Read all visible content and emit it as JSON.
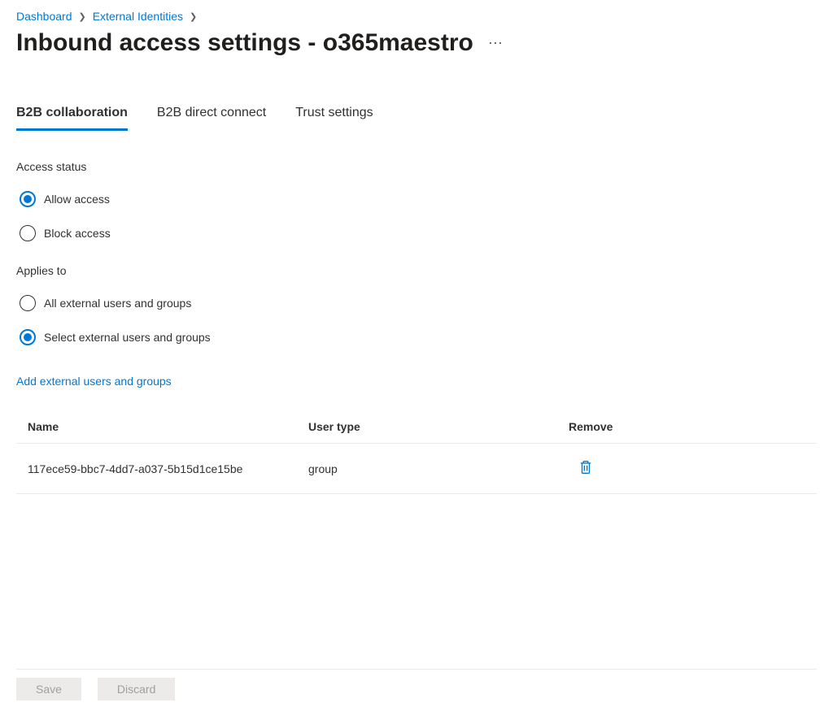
{
  "breadcrumb": {
    "items": [
      {
        "label": "Dashboard"
      },
      {
        "label": "External Identities"
      }
    ]
  },
  "page": {
    "title": "Inbound access settings - o365maestro"
  },
  "tabs": [
    {
      "label": "B2B collaboration",
      "active": true
    },
    {
      "label": "B2B direct connect",
      "active": false
    },
    {
      "label": "Trust settings",
      "active": false
    }
  ],
  "access_status": {
    "label": "Access status",
    "options": [
      {
        "label": "Allow access",
        "checked": true
      },
      {
        "label": "Block access",
        "checked": false
      }
    ]
  },
  "applies_to": {
    "label": "Applies to",
    "options": [
      {
        "label": "All external users and groups",
        "checked": false
      },
      {
        "label": "Select external users and groups",
        "checked": true
      }
    ]
  },
  "add_link": "Add external users and groups",
  "table": {
    "headers": {
      "name": "Name",
      "user_type": "User type",
      "remove": "Remove"
    },
    "rows": [
      {
        "name": "117ece59-bbc7-4dd7-a037-5b15d1ce15be",
        "user_type": "group"
      }
    ]
  },
  "footer": {
    "save": "Save",
    "discard": "Discard"
  }
}
